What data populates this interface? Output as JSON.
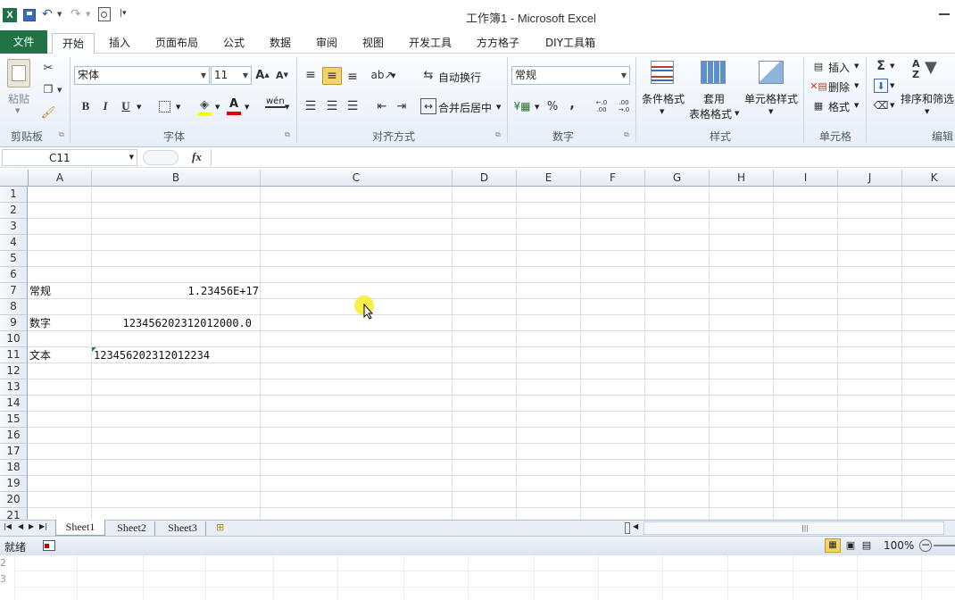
{
  "window": {
    "title": "工作簿1 - Microsoft Excel"
  },
  "ribbon_tabs": {
    "file": "文件",
    "items": [
      "开始",
      "插入",
      "页面布局",
      "公式",
      "数据",
      "审阅",
      "视图",
      "开发工具",
      "方方格子",
      "DIY工具箱"
    ]
  },
  "clipboard": {
    "paste": "粘贴",
    "group": "剪贴板"
  },
  "font": {
    "name": "宋体",
    "size": "11",
    "bold": "B",
    "italic": "I",
    "underline": "U",
    "font_color_glyph": "A",
    "phonetic": "wén",
    "group": "字体"
  },
  "alignment": {
    "wrap": "自动换行",
    "merge": "合并后居中",
    "group": "对齐方式"
  },
  "number": {
    "format": "常规",
    "percent": "%",
    "comma": ",",
    "inc_dec": "←.0 .00",
    "dec_dec": ".00 →.0",
    "group": "数字"
  },
  "styles": {
    "conditional": "条件格式",
    "table_fmt_1": "套用",
    "table_fmt_2": "表格格式",
    "cell_styles": "单元格样式",
    "group": "样式"
  },
  "cells": {
    "insert": "插入",
    "delete": "删除",
    "format": "格式",
    "group": "单元格"
  },
  "editing": {
    "sum": "Σ",
    "sort": "排序和筛选",
    "group": "编辑"
  },
  "formula_bar": {
    "name_box": "C11",
    "fx": "fx",
    "content": ""
  },
  "columns": [
    "A",
    "B",
    "C",
    "D",
    "E",
    "F",
    "G",
    "H",
    "I",
    "J",
    "K"
  ],
  "rows": [
    "1",
    "2",
    "3",
    "4",
    "5",
    "6",
    "7",
    "8",
    "9",
    "10",
    "11",
    "12",
    "13",
    "14",
    "15",
    "16",
    "17",
    "18",
    "19",
    "20",
    "21"
  ],
  "cell_values": {
    "a7": "常规",
    "b7": "1.23456E+17",
    "a9": "数字",
    "b9": "123456202312012000.0",
    "a11": "文本",
    "b11": "123456202312012234"
  },
  "sheets": [
    "Sheet1",
    "Sheet2",
    "Sheet3"
  ],
  "status": {
    "ready": "就绪",
    "zoom": "100%"
  },
  "ghost_rows": [
    "2",
    "3"
  ],
  "colors": {
    "file_tab": "#217346",
    "accent": "#f7d26b",
    "grid": "#dadfe6"
  }
}
